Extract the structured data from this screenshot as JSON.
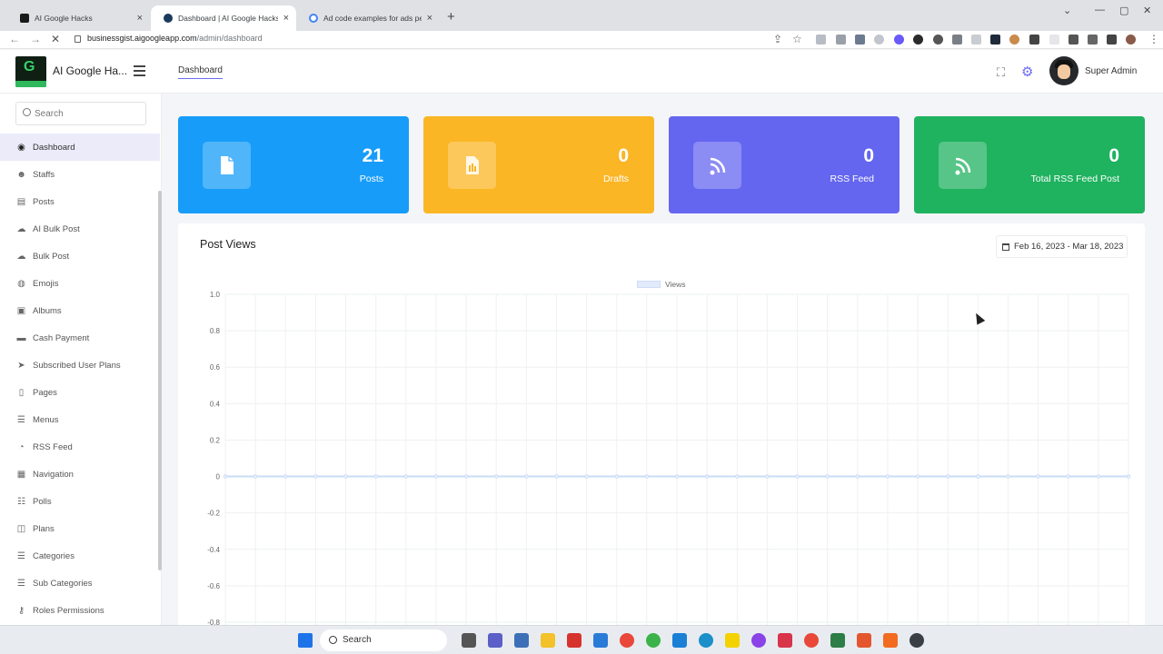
{
  "browser": {
    "tabs": [
      {
        "label": "AI Google Hacks",
        "favicon_color": "#1a1a1a"
      },
      {
        "label": "Dashboard | AI Google Hacks",
        "favicon_color": "#1c3a5e"
      },
      {
        "label": "Ad code examples for ads perso",
        "favicon_color": "#4285f4"
      }
    ],
    "url_host": "businessgist.aigoogleapp.com",
    "url_path": "/admin/dashboard"
  },
  "app": {
    "logo_letter": "G",
    "brand": "AI Google Ha...",
    "breadcrumb": "Dashboard",
    "user_name": "Super Admin"
  },
  "sidebar": {
    "search_placeholder": "Search",
    "items": [
      {
        "label": "Dashboard",
        "icon": "dashboard-icon",
        "glyph": "◉"
      },
      {
        "label": "Staffs",
        "icon": "users-icon",
        "glyph": "☻"
      },
      {
        "label": "Posts",
        "icon": "document-icon",
        "glyph": "▤"
      },
      {
        "label": "AI Bulk Post",
        "icon": "cloud-icon",
        "glyph": "☁"
      },
      {
        "label": "Bulk Post",
        "icon": "cloud-upload-icon",
        "glyph": "☁"
      },
      {
        "label": "Emojis",
        "icon": "globe-icon",
        "glyph": "◍"
      },
      {
        "label": "Albums",
        "icon": "images-icon",
        "glyph": "▣"
      },
      {
        "label": "Cash Payment",
        "icon": "wallet-icon",
        "glyph": "▬"
      },
      {
        "label": "Subscribed User Plans",
        "icon": "paper-plane-icon",
        "glyph": "➤"
      },
      {
        "label": "Pages",
        "icon": "page-icon",
        "glyph": "▯"
      },
      {
        "label": "Menus",
        "icon": "list-icon",
        "glyph": "☰"
      },
      {
        "label": "RSS Feed",
        "icon": "rss-icon",
        "glyph": "◔"
      },
      {
        "label": "Navigation",
        "icon": "grid-icon",
        "glyph": "▦"
      },
      {
        "label": "Polls",
        "icon": "bullet-list-icon",
        "glyph": "☷"
      },
      {
        "label": "Plans",
        "icon": "columns-icon",
        "glyph": "◫"
      },
      {
        "label": "Categories",
        "icon": "category-list-icon",
        "glyph": "☰"
      },
      {
        "label": "Sub Categories",
        "icon": "sub-list-icon",
        "glyph": "☰"
      },
      {
        "label": "Roles Permissions",
        "icon": "key-icon",
        "glyph": "⚷"
      }
    ]
  },
  "cards": [
    {
      "value": "21",
      "label": "Posts",
      "color": "#179cf9",
      "icon": "document-icon"
    },
    {
      "value": "0",
      "label": "Drafts",
      "color": "#fbb626",
      "icon": "draft-document-icon"
    },
    {
      "value": "0",
      "label": "RSS Feed",
      "color": "#6466f0",
      "icon": "rss-icon"
    },
    {
      "value": "0",
      "label": "Total RSS Feed Post",
      "color": "#1fb25f",
      "icon": "rss-icon"
    }
  ],
  "chart": {
    "title": "Post Views",
    "date_range": "Feb 16, 2023 - Mar 18, 2023"
  },
  "chart_data": {
    "type": "line",
    "title": "Post Views",
    "series": [
      {
        "name": "Views",
        "values": [
          0,
          0,
          0,
          0,
          0,
          0,
          0,
          0,
          0,
          0,
          0,
          0,
          0,
          0,
          0,
          0,
          0,
          0,
          0,
          0,
          0,
          0,
          0,
          0,
          0,
          0,
          0,
          0,
          0,
          0,
          0
        ]
      }
    ],
    "ylim": [
      -0.8,
      1.0
    ],
    "yticks": [
      "1.0",
      "0.8",
      "0.6",
      "0.4",
      "0.2",
      "0",
      "-0.2",
      "-0.4",
      "-0.6",
      "-0.8"
    ],
    "grid": true,
    "legend": "top-center",
    "series_color": "#c9dcf7"
  },
  "taskbar": {
    "search_label": "Search"
  }
}
